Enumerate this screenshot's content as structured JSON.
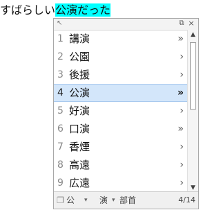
{
  "composition": {
    "prefix": "すばらしい",
    "highlighted": "公演だった"
  },
  "candidate_window": {
    "toolbar": {
      "restore_icon": "⧉",
      "close_icon": "×"
    },
    "candidates": [
      {
        "number": "1",
        "text": "講演",
        "arrow": "»"
      },
      {
        "number": "2",
        "text": "公園",
        "arrow": "›"
      },
      {
        "number": "3",
        "text": "後援",
        "arrow": "›"
      },
      {
        "number": "4",
        "text": "公演",
        "arrow": "»"
      },
      {
        "number": "5",
        "text": "好演",
        "arrow": "›"
      },
      {
        "number": "6",
        "text": "口演",
        "arrow": "»"
      },
      {
        "number": "7",
        "text": "香煙",
        "arrow": "›"
      },
      {
        "number": "8",
        "text": "高遠",
        "arrow": "›"
      },
      {
        "number": "9",
        "text": "広遠",
        "arrow": "›"
      }
    ],
    "selected_index": 3,
    "footer": {
      "button1": "公",
      "button2": "演",
      "button3": "部首",
      "page_indicator": "4/14"
    }
  }
}
